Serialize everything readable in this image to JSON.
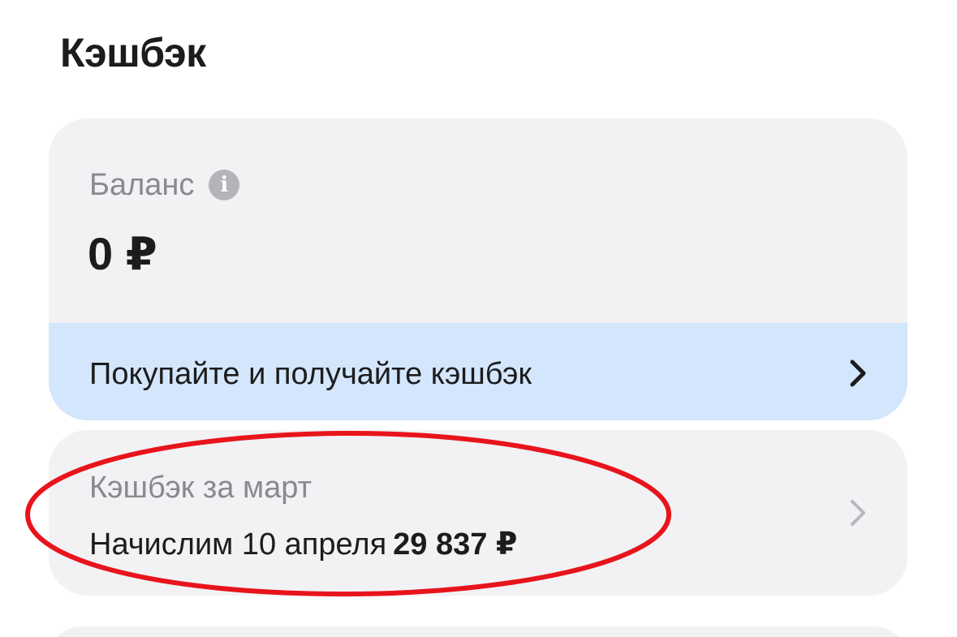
{
  "page": {
    "title": "Кэшбэк"
  },
  "balance": {
    "label": "Баланс",
    "info_icon": "info-icon",
    "amount": "0 ₽"
  },
  "promo": {
    "text": "Покупайте и получайте кэшбэк",
    "icon": "chevron-right-icon"
  },
  "monthly": {
    "label": "Кэшбэк за март",
    "accrual_text": "Начислим 10 апреля",
    "amount": "29 837 ₽",
    "icon": "chevron-right-icon"
  },
  "colors": {
    "card_background": "#f2f2f4",
    "promo_background": "#d3e6fb",
    "secondary_text": "#8a8a8e",
    "annotation": "#e8141c"
  }
}
